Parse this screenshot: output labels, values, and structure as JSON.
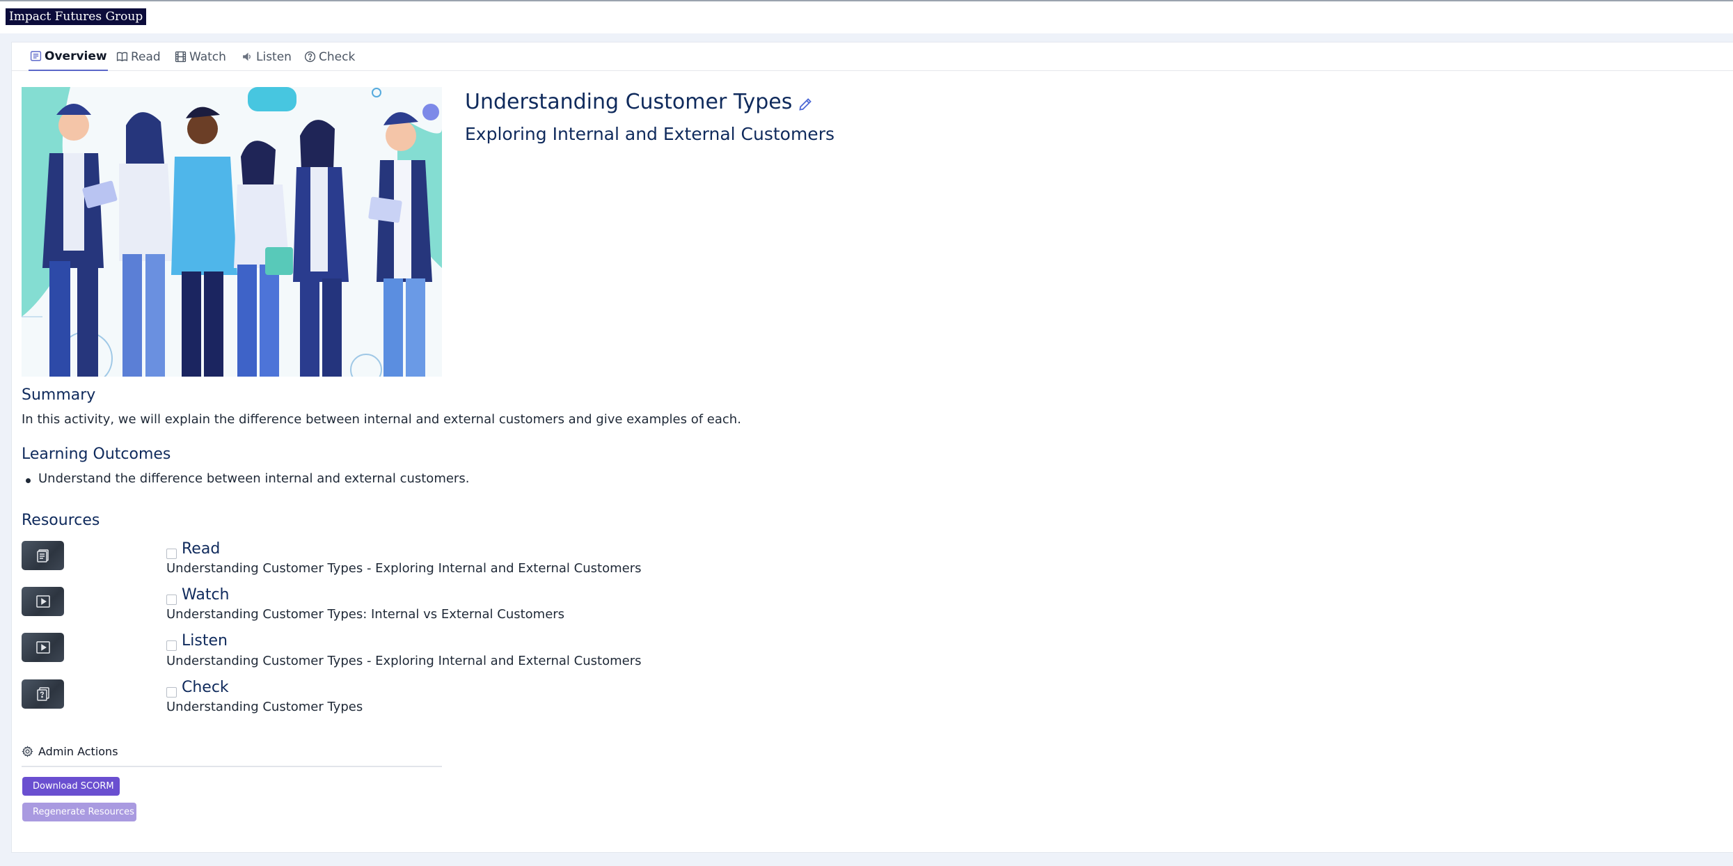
{
  "brand": {
    "name": "Impact Futures Group"
  },
  "tabs": [
    {
      "label": "Overview",
      "icon": "list-icon",
      "active": true
    },
    {
      "label": "Read",
      "icon": "book-icon",
      "active": false
    },
    {
      "label": "Watch",
      "icon": "film-icon",
      "active": false
    },
    {
      "label": "Listen",
      "icon": "audio-icon",
      "active": false
    },
    {
      "label": "Check",
      "icon": "question-icon",
      "active": false
    }
  ],
  "activity": {
    "title": "Understanding Customer Types",
    "subtitle": "Exploring Internal and External Customers"
  },
  "summary": {
    "heading": "Summary",
    "text": "In this activity, we will explain the difference between internal and external customers and give examples of each."
  },
  "outcomes": {
    "heading": "Learning Outcomes",
    "items": [
      "Understand the difference between internal and external customers."
    ]
  },
  "resources": {
    "heading": "Resources",
    "items": [
      {
        "type": "Read",
        "icon": "document-icon",
        "description": "Understanding Customer Types - Exploring Internal and External Customers"
      },
      {
        "type": "Watch",
        "icon": "play-icon",
        "description": "Understanding Customer Types: Internal vs External Customers"
      },
      {
        "type": "Listen",
        "icon": "play-icon",
        "description": "Understanding Customer Types - Exploring Internal and External Customers"
      },
      {
        "type": "Check",
        "icon": "quiz-icon",
        "description": "Understanding Customer Types"
      }
    ]
  },
  "admin": {
    "label": "Admin Actions",
    "download_label": "Download SCORM",
    "regenerate_label": "Regenerate Resources"
  },
  "colors": {
    "heading": "#0f2a5c",
    "primary_button": "#6a4fd0",
    "secondary_button": "#a99ae0",
    "brand_bg": "#0c0c3b",
    "active_tab_underline": "#5b67c9"
  }
}
